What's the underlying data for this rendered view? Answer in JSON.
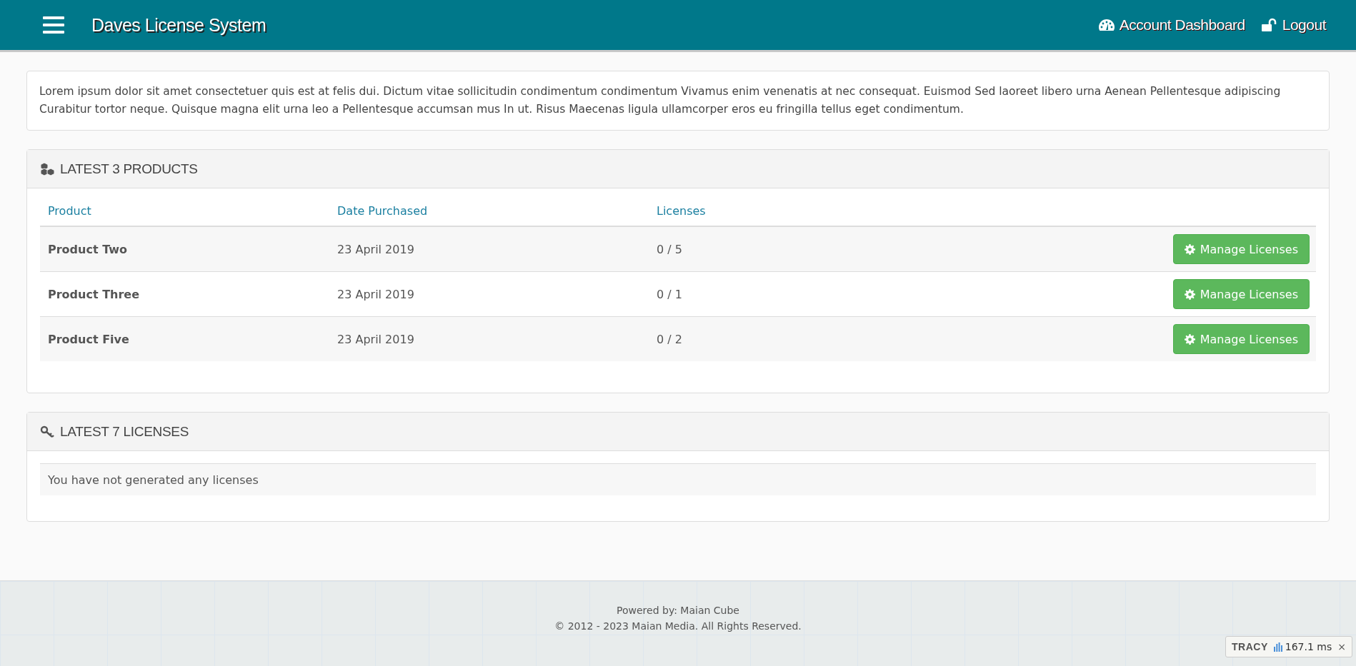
{
  "header": {
    "title": "Daves License System",
    "nav": [
      {
        "kind": "dashboard",
        "label": "Account Dashboard"
      },
      {
        "kind": "logout",
        "label": "Logout"
      }
    ]
  },
  "intro": "Lorem ipsum dolor sit amet consectetuer quis est at felis dui. Dictum vitae sollicitudin condimentum condimentum Vivamus enim venenatis at nec consequat. Euismod Sed laoreet libero urna Aenean Pellentesque adipiscing Curabitur tortor neque. Quisque magna elit urna leo a Pellentesque accumsan mus In ut. Risus Maecenas ligula ullamcorper eros eu fringilla tellus eget condimentum.",
  "products_panel": {
    "title": "LATEST 3 PRODUCTS",
    "columns": [
      "Product",
      "Date Purchased",
      "Licenses"
    ],
    "rows": [
      {
        "product": "Product Two",
        "date": "23 April 2019",
        "licenses": "0 / 5",
        "action": "Manage Licenses"
      },
      {
        "product": "Product Three",
        "date": "23 April 2019",
        "licenses": "0 / 1",
        "action": "Manage Licenses"
      },
      {
        "product": "Product Five",
        "date": "23 April 2019",
        "licenses": "0 / 2",
        "action": "Manage Licenses"
      }
    ]
  },
  "licenses_panel": {
    "title": "LATEST 7 LICENSES",
    "empty_message": "You have not generated any licenses"
  },
  "footer": {
    "powered_by": "Powered by: Maian Cube",
    "copyright": "© 2012 - 2023 Maian Media. All Rights Reserved."
  },
  "debug_bar": {
    "label": "TRACY",
    "time": "167.1 ms",
    "close": "×"
  }
}
